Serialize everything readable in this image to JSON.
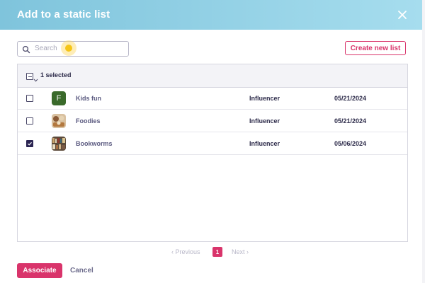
{
  "modal": {
    "title": "Add to a static list",
    "close_icon": "close-icon",
    "header_gradient": [
      "#7fc4dc",
      "#a6ddee"
    ]
  },
  "search": {
    "placeholder": "Search",
    "value": "",
    "icon": "search-icon"
  },
  "toolbar": {
    "create_label": "Create new list"
  },
  "table": {
    "selected_count_label": "1 selected",
    "rows": [
      {
        "name": "Kids fun",
        "type": "Influencer",
        "date": "05/21/2024",
        "checked": false,
        "avatar_letter": "F",
        "avatar_color": "#3a6a2b"
      },
      {
        "name": "Foodies",
        "type": "Influencer",
        "date": "05/21/2024",
        "checked": false,
        "avatar_image": "food-photo-thumbnail"
      },
      {
        "name": "Bookworms",
        "type": "Influencer",
        "date": "05/06/2024",
        "checked": true,
        "avatar_image": "bookshelf-photo-thumbnail"
      }
    ]
  },
  "pagination": {
    "previous_label": "Previous",
    "next_label": "Next",
    "current_page": "1"
  },
  "footer": {
    "associate_label": "Associate",
    "cancel_label": "Cancel"
  },
  "colors": {
    "accent": "#d9346b",
    "checked": "#2b2452",
    "text": "#2d2b4a"
  }
}
